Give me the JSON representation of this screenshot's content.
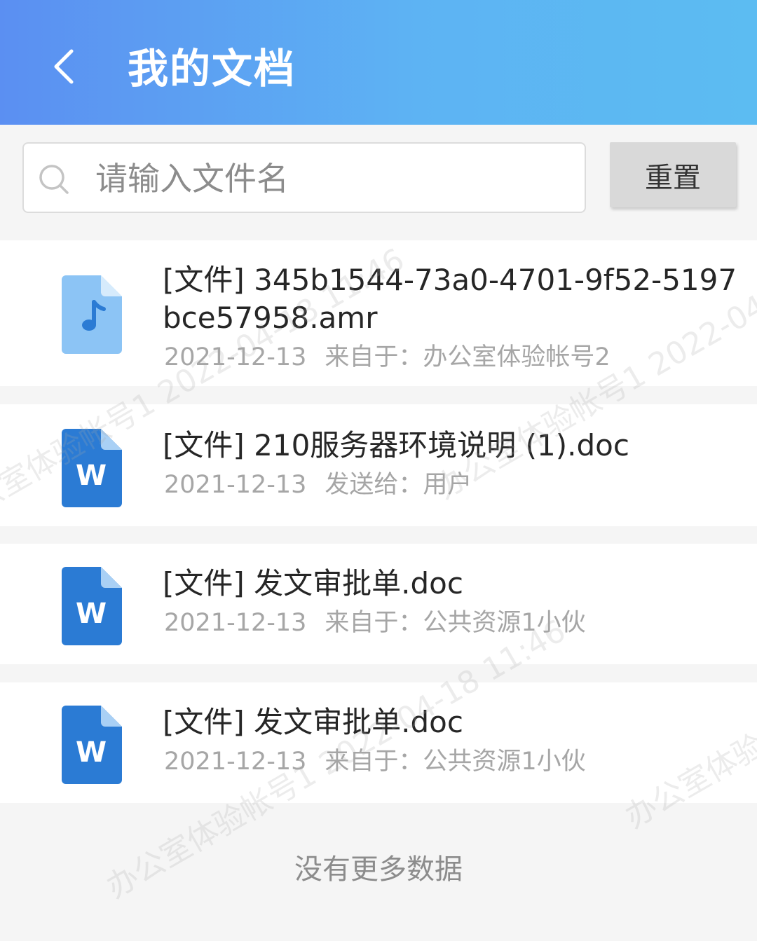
{
  "header": {
    "back_icon": "chevron-left-icon",
    "title": "我的文档"
  },
  "search": {
    "icon": "search-icon",
    "placeholder": "请输入文件名",
    "value": "",
    "reset_label": "重置"
  },
  "files": [
    {
      "icon": "audio-file-icon",
      "title": "[文件] 345b1544-73a0-4701-9f52-5197bce57958.amr",
      "date": "2021-12-13",
      "relation": "来自于：办公室体验帐号2"
    },
    {
      "icon": "word-file-icon",
      "icon_letter": "W",
      "title": "[文件] 210服务器环境说明 (1).doc",
      "date": "2021-12-13",
      "relation": "发送给：用户"
    },
    {
      "icon": "word-file-icon",
      "icon_letter": "W",
      "title": "[文件] 发文审批单.doc",
      "date": "2021-12-13",
      "relation": "来自于：公共资源1小伙"
    },
    {
      "icon": "word-file-icon",
      "icon_letter": "W",
      "title": "[文件] 发文审批单.doc",
      "date": "2021-12-13",
      "relation": "来自于：公共资源1小伙"
    }
  ],
  "footer": {
    "no_more": "没有更多数据"
  },
  "watermark": {
    "text": "办公室体验帐号1 2022-04-18 11:46"
  },
  "colors": {
    "header_start": "#5b8ff2",
    "header_end": "#5cbcf2",
    "word_icon": "#2b7bd4",
    "audio_icon": "#8cc4f5"
  }
}
